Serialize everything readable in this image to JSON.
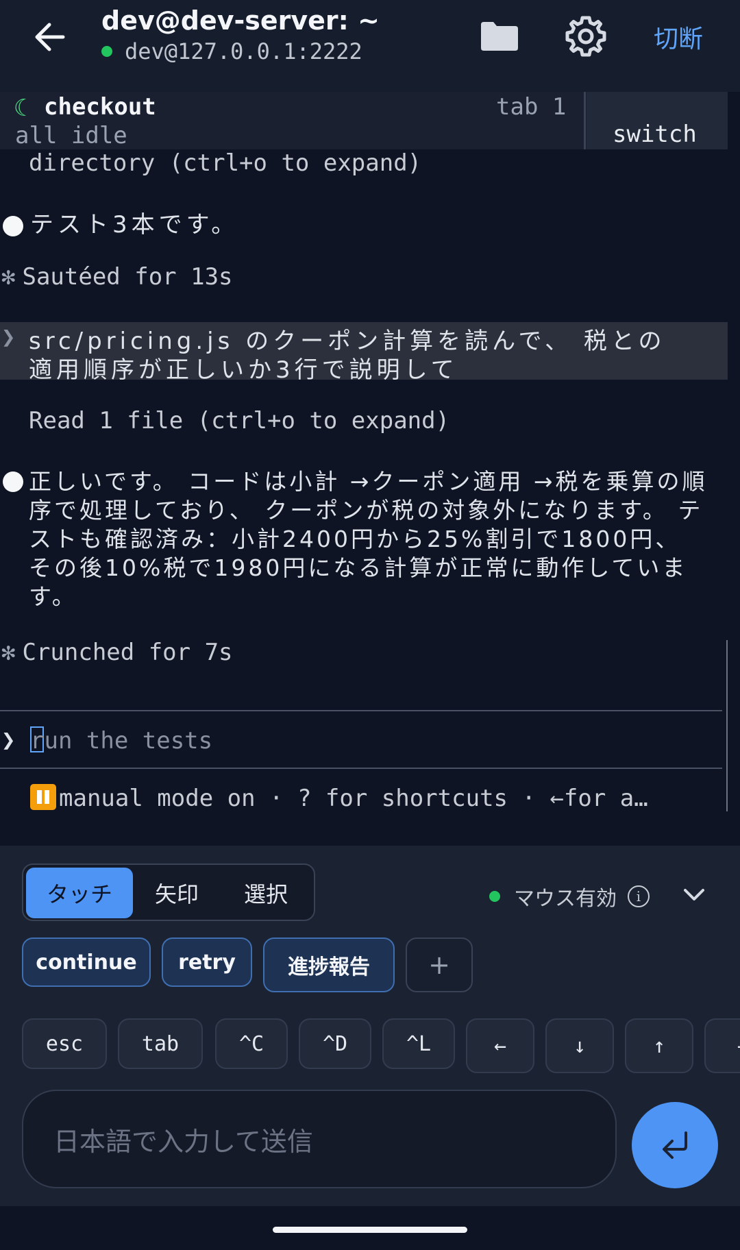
{
  "header": {
    "title": "dev@dev-server: ~",
    "connection": "dev@127.0.0.1:2222",
    "disconnect_label": "切断",
    "status_color": "#22c55e"
  },
  "terminal": {
    "tab": {
      "name": "checkout",
      "status": "all idle",
      "index": "tab 1",
      "switch_label": "switch"
    },
    "lines": {
      "dir_collapsed": "directory (ctrl+o to expand)",
      "tests_count": "テスト3本です。",
      "sauteed": "Sautéed for 13s",
      "user_msg_line1": "src/pricing.js のクーポン計算を読んで、 税との",
      "user_msg_line2": "適用順序が正しいか3行で説明して",
      "read_file": "Read 1 file (ctrl+o to expand)",
      "answer": "正しいです。 コードは小計 →クーポン適用 →税を乗算の順序で処理しており、 クーポンが税の対象外になります。 テストも確認済み：小計2400円から25%割引で1800円、 その後10%税で1980円になる計算が正常に動作しています。",
      "crunched": "Crunched for 7s"
    },
    "prompt": {
      "caret": "❯",
      "first_char": "r",
      "rest": "un the tests"
    },
    "status_line": "manual mode on · ? for shortcuts · ←for a…"
  },
  "panel": {
    "modes": [
      "タッチ",
      "矢印",
      "選択"
    ],
    "active_mode": "タッチ",
    "mouse_status": "マウス有効",
    "quick_replies": [
      "continue",
      "retry",
      "進捗報告"
    ],
    "add_label": "+",
    "keys": [
      "esc",
      "tab",
      "^C",
      "^D",
      "^L",
      "←",
      "↓",
      "↑",
      "→"
    ],
    "input_placeholder": "日本語で入力して送信"
  },
  "icons": {
    "back": "arrow-left-icon",
    "folder": "folder-icon",
    "settings": "gear-icon",
    "info": "info-icon",
    "collapse": "chevron-down-icon",
    "send": "enter-return-icon",
    "pause": "pause-icon"
  }
}
